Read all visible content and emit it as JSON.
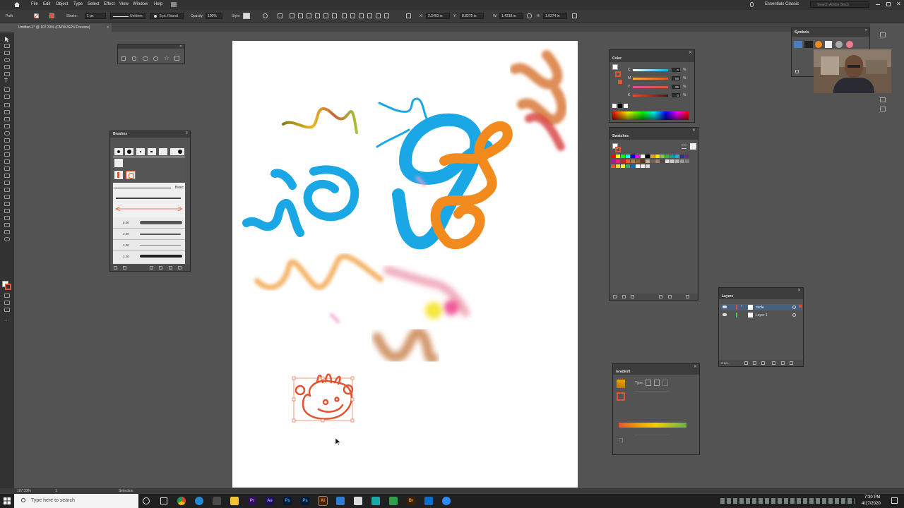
{
  "menubar": {
    "items": [
      "File",
      "Edit",
      "Object",
      "Type",
      "Select",
      "Effect",
      "View",
      "Window",
      "Help"
    ],
    "workspace": "Essentials Classic",
    "search_placeholder": "Search Adobe Stock"
  },
  "control_bar": {
    "selection_type": "Path",
    "stroke_label": "Stroke:",
    "stroke_weight": "1 px",
    "profile": "Uniform",
    "brush": "5 pt. Round",
    "opacity_label": "Opacity:",
    "opacity_value": "100%",
    "style_label": "Style:",
    "x_label": "X:",
    "x_value": "2.2403 in",
    "y_label": "Y:",
    "y_value": "8.8275 in",
    "w_label": "W:",
    "w_value": "1.4218 in",
    "h_label": "H:",
    "h_value": "1.0274 in"
  },
  "document_tab": "Untitled-1* @ 107.33% (CMYK/GPU Preview)",
  "brushes_panel": {
    "title": "Brushes",
    "basic_label": "Basic",
    "brush_sizes": [
      "6.00",
      "3.00",
      "4.00",
      "4.20"
    ]
  },
  "color_panel": {
    "title": "Color",
    "channels": [
      {
        "label": "C",
        "value": "0"
      },
      {
        "label": "M",
        "value": "88"
      },
      {
        "label": "Y",
        "value": "95"
      },
      {
        "label": "K",
        "value": "0"
      }
    ],
    "unit": "%"
  },
  "swatches_panel": {
    "title": "Swatches"
  },
  "symbols_panel": {
    "title": "Symbols"
  },
  "layers_panel": {
    "title": "Layers",
    "layers": [
      {
        "name": "circle",
        "selected": true,
        "color": "#e84545"
      },
      {
        "name": "Layer 1",
        "selected": false,
        "color": "#4fc24f"
      }
    ],
    "count": "2 La..."
  },
  "gradient_panel": {
    "title": "Gradient",
    "type_label": "Type:"
  },
  "status_bar": {
    "zoom": "107.33%",
    "artboard": "1",
    "tool": "Selection"
  },
  "taskbar": {
    "search_placeholder": "Type here to search",
    "apps": [
      {
        "name": "Pr",
        "color": "#2d0f5a",
        "fg": "#ea77ff"
      },
      {
        "name": "Ae",
        "color": "#1f0f5a",
        "fg": "#a2a2ff"
      },
      {
        "name": "Ps",
        "color": "#041a33",
        "fg": "#31a8ff"
      },
      {
        "name": "Ps",
        "color": "#041a33",
        "fg": "#31a8ff"
      },
      {
        "name": "Ai",
        "color": "#4a2300",
        "fg": "#ff9a00"
      },
      {
        "name": "Br",
        "color": "#3a2200",
        "fg": "#e8a03a"
      }
    ],
    "time": "7:30 PM",
    "date": "4/17/2020"
  },
  "colors": {
    "accent_blue": "#1aa7e6",
    "accent_orange": "#f28a1e",
    "selection_red": "#e4542e"
  }
}
